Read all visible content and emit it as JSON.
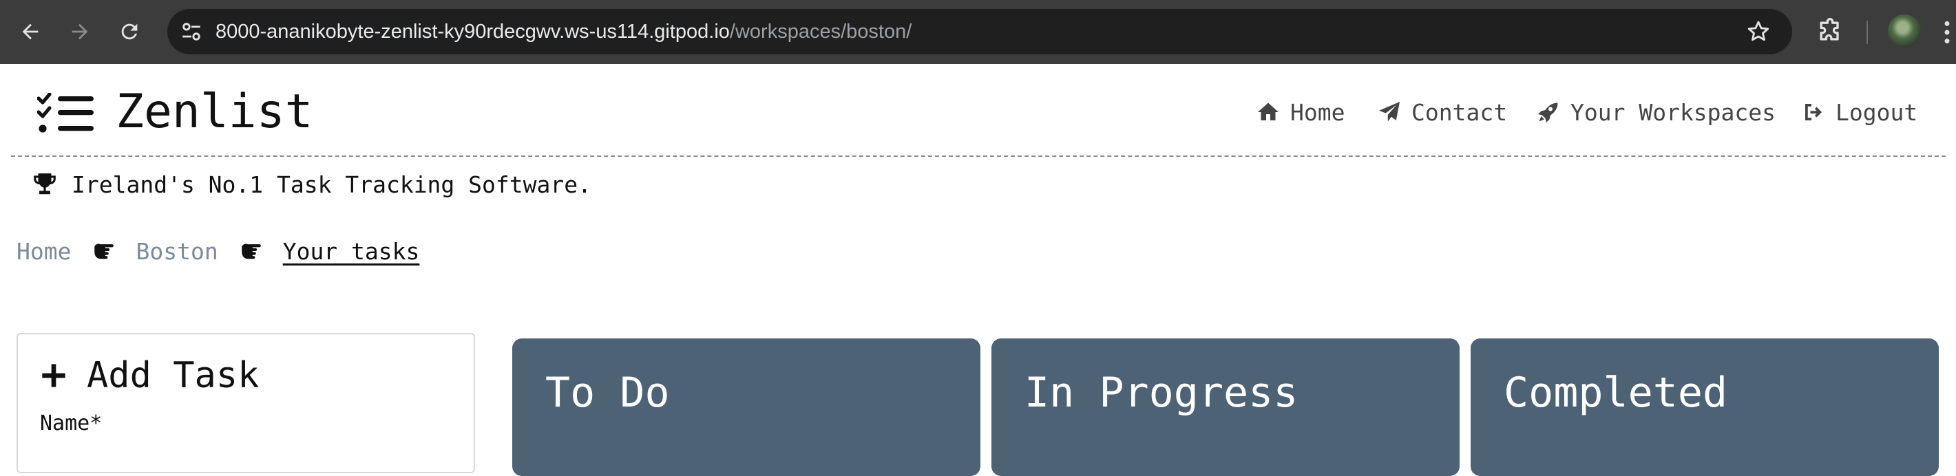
{
  "browser": {
    "url_host": "8000-ananikobyte-zenlist-ky90rdecgwv.ws-us114.gitpod.io",
    "url_path": "/workspaces/boston/"
  },
  "site": {
    "brand": "Zenlist",
    "nav": [
      {
        "label": "Home",
        "icon": "house-icon"
      },
      {
        "label": "Contact",
        "icon": "paper-plane-icon"
      },
      {
        "label": "Your Workspaces",
        "icon": "rocket-icon"
      },
      {
        "label": "Logout",
        "icon": "logout-icon"
      }
    ],
    "tagline": "Ireland's No.1 Task Tracking Software."
  },
  "breadcrumb": {
    "items": [
      "Home",
      "Boston",
      "Your tasks"
    ],
    "separator_icon": "hand-pointing-right-icon"
  },
  "add_task": {
    "title": "Add Task",
    "name_label": "Name*"
  },
  "columns": [
    {
      "title": "To Do"
    },
    {
      "title": "In Progress"
    },
    {
      "title": "Completed"
    }
  ],
  "colors": {
    "chrome_bg": "#3c3c3c",
    "omnibox_bg": "#1f1f1f",
    "column_bg": "#4d6375",
    "breadcrumb_link": "#7b8b99"
  }
}
